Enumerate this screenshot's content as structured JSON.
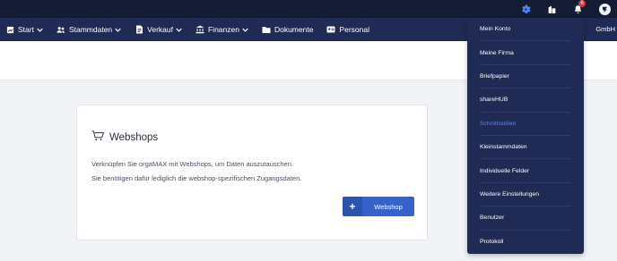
{
  "header": {
    "notification_count": "6",
    "firm_name_tail": "GmbH"
  },
  "nav": {
    "items": [
      {
        "label": "Start",
        "icon": "start-icon",
        "dropdown": true
      },
      {
        "label": "Stammdaten",
        "icon": "users-icon",
        "dropdown": true
      },
      {
        "label": "Verkauf",
        "icon": "document-edit-icon",
        "dropdown": true
      },
      {
        "label": "Finanzen",
        "icon": "bank-icon",
        "dropdown": true
      },
      {
        "label": "Dokumente",
        "icon": "folder-icon",
        "dropdown": false
      },
      {
        "label": "Personal",
        "icon": "id-card-icon",
        "dropdown": false
      }
    ]
  },
  "webshops": {
    "title": "Webshops",
    "line1": "Verknüpfen Sie orgaMAX mit Webshops, um Daten auszutauschen.",
    "line2": "Sie benötigen dafür lediglich die webshop-spezifischen Zugangsdaten.",
    "button_label": "Webshop",
    "button_plus": "+"
  },
  "settings_menu": {
    "items": [
      {
        "label": "Mein Konto",
        "active": false
      },
      {
        "label": "Meine Firma",
        "active": false
      },
      {
        "label": "Briefpapier",
        "active": false
      },
      {
        "label": "shareHUB",
        "active": false
      },
      {
        "label": "Schnittstellen",
        "active": true
      },
      {
        "label": "Kleinstammdaten",
        "active": false
      },
      {
        "label": "Individuelle Felder",
        "active": false
      },
      {
        "label": "Weitere Einstellungen",
        "active": false
      },
      {
        "label": "Benutzer",
        "active": false
      },
      {
        "label": "Protokoll",
        "active": false
      }
    ]
  },
  "colors": {
    "topbar": "#131c33",
    "navbar": "#1f2a55",
    "accent": "#3563c9",
    "active_menu": "#5b86f0",
    "badge": "#e0303b"
  }
}
